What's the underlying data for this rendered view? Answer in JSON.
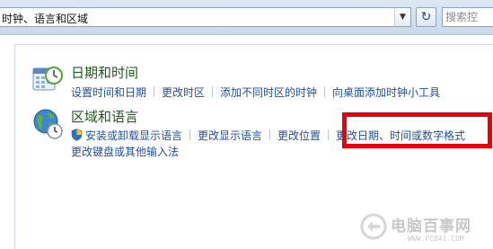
{
  "address_bar": {
    "path": "时钟、语言和区域",
    "dropdown_glyph": "▼",
    "refresh_glyph": "↻",
    "search_placeholder": "搜索控"
  },
  "categories": [
    {
      "title": "日期和时间",
      "icon": "calendar-clock-icon",
      "links": [
        "设置时间和日期",
        "更改时区",
        "添加不同时区的时钟",
        "向桌面添加时钟小工具"
      ]
    },
    {
      "title": "区域和语言",
      "icon": "globe-clock-icon",
      "links": [
        "安装或卸载显示语言",
        "更改显示语言",
        "更改位置",
        "更改日期、时间或数字格式",
        "更改键盘或其他输入法"
      ]
    }
  ],
  "colors": {
    "title_green": "#1e5a1e",
    "link_blue": "#1f4f9a",
    "highlight_red": "#e8000b"
  },
  "watermark": {
    "text": "电脑百事网",
    "url": "WWW.PC841.COM"
  }
}
